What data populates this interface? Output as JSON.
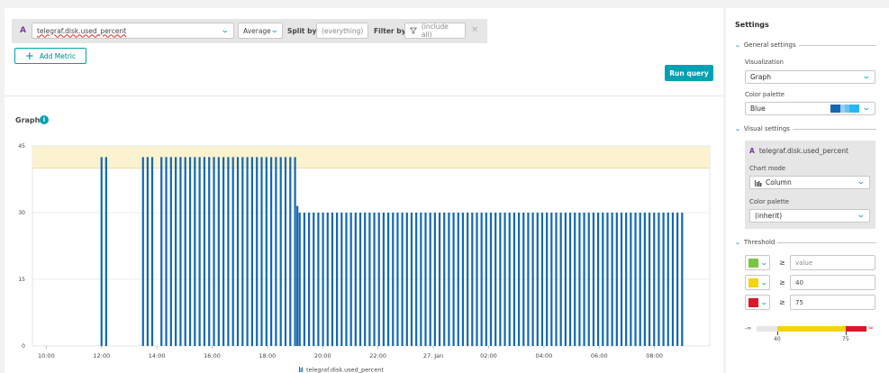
{
  "query": {
    "letter": "A",
    "metric": "telegraf.disk.used_percent",
    "aggregation": "Average",
    "split_by_label": "Split by",
    "split_by_placeholder": "(everything)",
    "filter_by_label": "Filter by",
    "filter_placeholder": "(include all)",
    "close_glyph": "✕",
    "add_metric_label": "Add Metric",
    "run_query_label": "Run query"
  },
  "graph": {
    "title": "Graph",
    "info_glyph": "i"
  },
  "chart_data": {
    "type": "bar",
    "title": "Graph",
    "xlabel": "",
    "ylabel": "",
    "x_ticks": [
      "10:00",
      "12:00",
      "14:00",
      "16:00",
      "18:00",
      "20:00",
      "22:00",
      "27. Jan",
      "02:00",
      "04:00",
      "06:00",
      "08:00"
    ],
    "y_ticks": [
      0,
      15,
      30,
      45
    ],
    "ylim": [
      0,
      45
    ],
    "threshold_band": {
      "from": 40,
      "to": 45,
      "color": "#fbf2cf"
    },
    "legend_position": "bottom-center",
    "grid": true,
    "series": [
      {
        "name": "telegraf.disk.used_percent",
        "color": "#1268b3",
        "segments": [
          {
            "x_start": "12:00",
            "x_end": "12:10",
            "count": 2,
            "value": 42.5
          },
          {
            "x_start": "13:30",
            "x_end": "13:50",
            "count": 3,
            "value": 42.5
          },
          {
            "x_start": "14:10",
            "x_end": "19:00",
            "count": 29,
            "value": 42.5
          },
          {
            "x_start": "19:05",
            "x_end": "19:05",
            "count": 1,
            "value": 31.5
          },
          {
            "x_start": "19:10",
            "x_end": "09:00",
            "count": 83,
            "value": 30
          }
        ]
      }
    ],
    "colors": {
      "bar": "#1268b3",
      "band": "#fbf2cf",
      "band_line": "#e8d9a4",
      "grid": "#e6e6e6"
    }
  },
  "settings": {
    "title": "Settings",
    "general_label": "General settings",
    "visualization_label": "Visualization",
    "visualization_value": "Graph",
    "color_palette_label": "Color palette",
    "color_palette_value": "Blue",
    "palette_swatches": [
      "#1268b3",
      "#9acfee",
      "#6cc3ea",
      "#2ab6f4"
    ],
    "visual_label": "Visual settings",
    "series_letter": "A",
    "series_metric": "telegraf.disk.used_percent",
    "chart_mode_label": "Chart mode",
    "chart_mode_value": "Column",
    "series_palette_label": "Color palette",
    "series_palette_value": "(inherit)",
    "threshold_label": "Threshold",
    "thresholds": [
      {
        "color": "#7dc540",
        "value": "",
        "placeholder": "value"
      },
      {
        "color": "#f5d30f",
        "value": "40",
        "placeholder": ""
      },
      {
        "color": "#dc172a",
        "value": "75",
        "placeholder": ""
      }
    ],
    "scale": {
      "neg_inf": "-∞",
      "mark1": "40",
      "mark2": "75",
      "pos_inf": "∞",
      "geq": "≥"
    }
  }
}
